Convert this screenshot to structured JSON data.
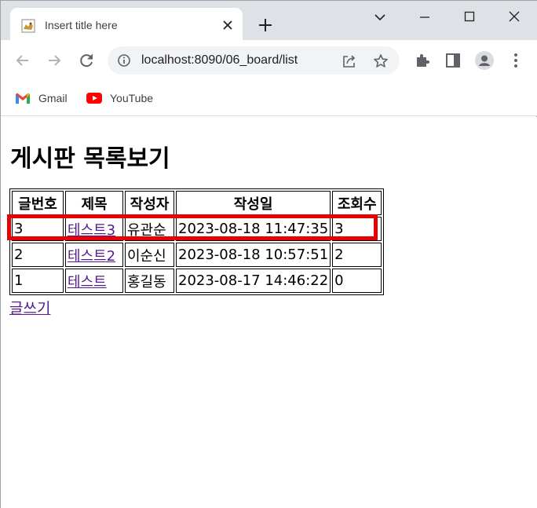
{
  "browser": {
    "tab": {
      "title": "Insert title here"
    },
    "address_bar": {
      "url": "localhost:8090/06_board/list"
    },
    "bookmarks": [
      {
        "label": "Gmail",
        "icon": "gmail-icon"
      },
      {
        "label": "YouTube",
        "icon": "youtube-icon"
      }
    ]
  },
  "page": {
    "title": "게시판 목록보기",
    "table": {
      "headers": [
        "글번호",
        "제목",
        "작성자",
        "작성일",
        "조회수"
      ],
      "rows": [
        {
          "no": "3",
          "subject": "테스트3",
          "writer": "유관순",
          "date": "2023-08-18 11:47:35",
          "views": "3"
        },
        {
          "no": "2",
          "subject": "테스트2",
          "writer": "이순신",
          "date": "2023-08-18 10:57:51",
          "views": "2"
        },
        {
          "no": "1",
          "subject": "테스트",
          "writer": "홍길동",
          "date": "2023-08-17 14:46:22",
          "views": "0"
        }
      ]
    },
    "write_link": "글쓰기"
  },
  "colors": {
    "highlight_border": "#e60000",
    "visited_link": "#551a8b",
    "tabstrip_bg": "#dee1e6",
    "omnibox_bg": "#f1f3f4"
  }
}
